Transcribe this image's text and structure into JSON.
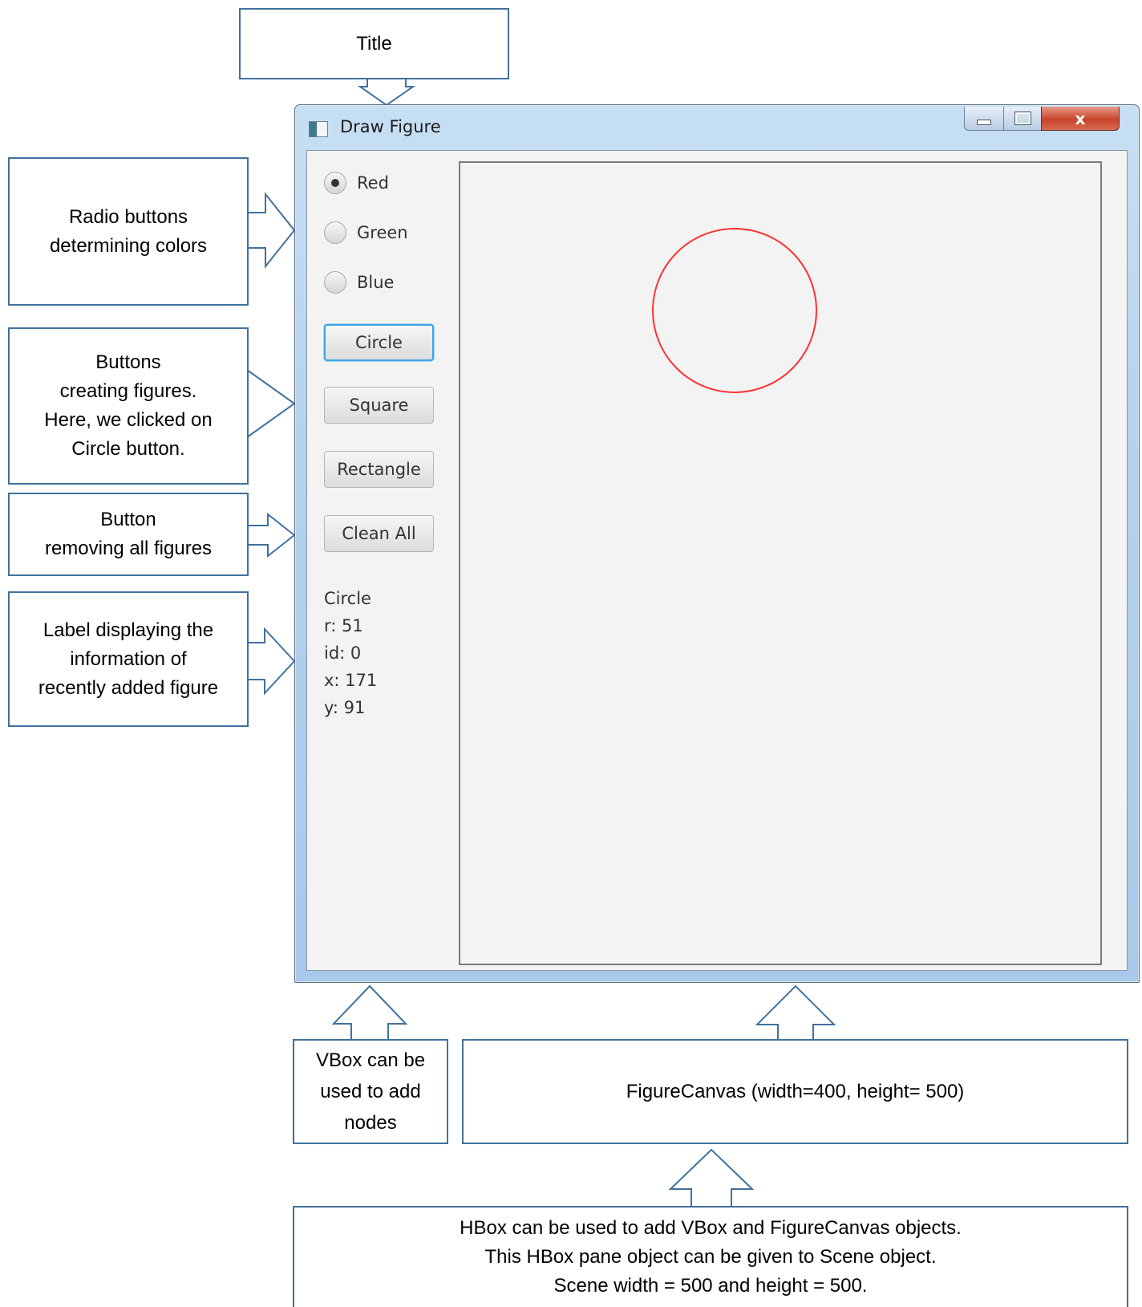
{
  "window": {
    "title": "Draw Figure",
    "close_glyph": "x"
  },
  "vbox": {
    "radios": [
      {
        "label": "Red",
        "checked": true
      },
      {
        "label": "Green",
        "checked": false
      },
      {
        "label": "Blue",
        "checked": false
      }
    ],
    "buttons": [
      {
        "label": "Circle",
        "focused": true
      },
      {
        "label": "Square",
        "focused": false
      },
      {
        "label": "Rectangle",
        "focused": false
      },
      {
        "label": "Clean All",
        "focused": false
      }
    ],
    "info_lines": [
      "Circle",
      "r: 51",
      "id: 0",
      "x: 171",
      "y: 91"
    ]
  },
  "canvas": {
    "figures": [
      {
        "type": "circle",
        "color": "#ff3333"
      }
    ]
  },
  "callouts": {
    "title": "Title",
    "radio_buttons": "Radio buttons\ndetermining colors",
    "buttons": "Buttons\ncreating figures.\nHere, we clicked on\nCircle button.",
    "clean_button": "Button\nremoving all figures",
    "label": "Label displaying the\ninformation of\nrecently added figure",
    "vbox": "VBox can be\nused to add\nnodes",
    "figure_canvas": "FigureCanvas (width=400, height= 500)",
    "hbox": "HBox can be used to add VBox and FigureCanvas objects.\nThis HBox pane object can be given to Scene object.\nScene width = 500 and height = 500."
  },
  "colors": {
    "callout_border": "#41719c",
    "focus_ring": "#3ca6e4",
    "circle_stroke": "#ff3333"
  }
}
